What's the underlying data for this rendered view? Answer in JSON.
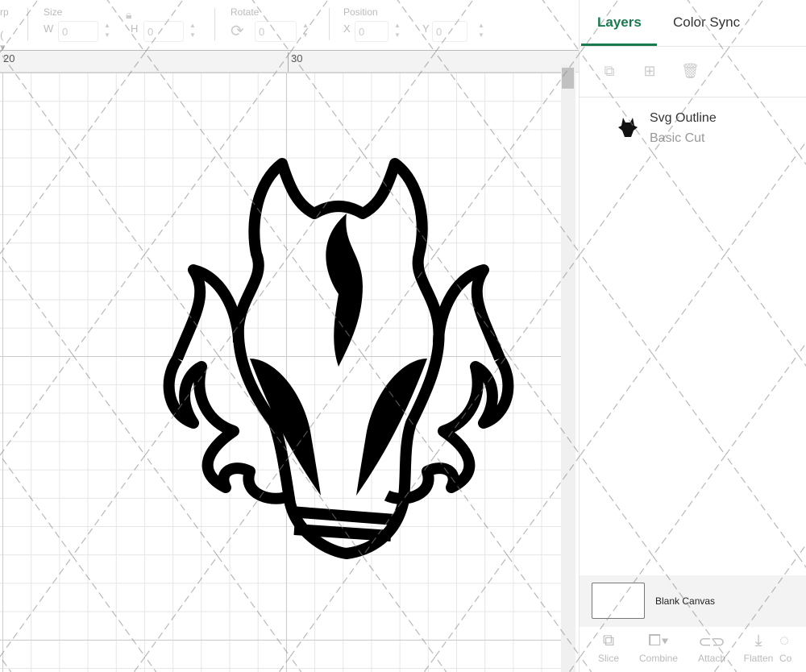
{
  "toolbar": {
    "warp_label": "rp",
    "size_label": "Size",
    "w_label": "W",
    "w_value": "0",
    "h_label": "H",
    "h_value": "0",
    "rotate_label": "Rotate",
    "rotate_value": "0",
    "position_label": "Position",
    "x_label": "X",
    "x_value": "0",
    "y_label": "Y",
    "y_value": "0"
  },
  "ruler": {
    "ticks": [
      "20",
      "30"
    ]
  },
  "panel": {
    "tabs": [
      {
        "label": "Layers",
        "active": true
      },
      {
        "label": "Color Sync",
        "active": false
      }
    ],
    "actions": [
      {
        "icon": "group-icon"
      },
      {
        "icon": "duplicate-icon"
      },
      {
        "icon": "delete-icon"
      }
    ],
    "layer": {
      "name": "Svg Outline",
      "type": "Basic Cut"
    },
    "canvas_label": "Blank Canvas",
    "tools": [
      {
        "label": "Slice",
        "icon": "slice-icon"
      },
      {
        "label": "Combine",
        "icon": "combine-icon"
      },
      {
        "label": "Attach",
        "icon": "attach-icon"
      },
      {
        "label": "Flatten",
        "icon": "flatten-icon"
      },
      {
        "label": "Co",
        "icon": "contour-icon"
      }
    ]
  },
  "colors": {
    "accent": "#1a7a4f"
  }
}
